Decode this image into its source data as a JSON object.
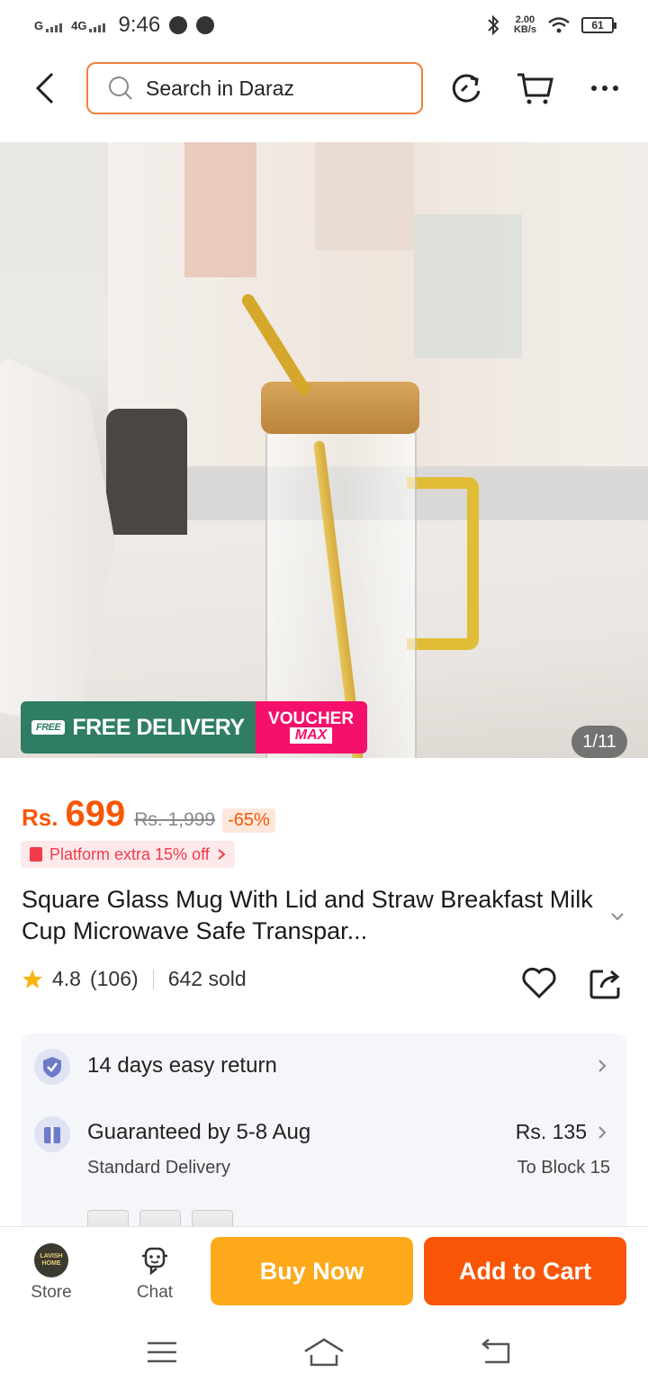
{
  "status_bar": {
    "signal1": "G",
    "signal2": "4G",
    "time": "9:46",
    "speed_value": "2.00",
    "speed_unit": "KB/s",
    "battery": "61"
  },
  "header": {
    "search_placeholder": "Search in Daraz",
    "icons": [
      "back-icon",
      "search-icon",
      "history-icon",
      "cart-icon",
      "more-icon"
    ]
  },
  "hero": {
    "free_badge": "FREE",
    "free_delivery": "FREE DELIVERY",
    "voucher_line1": "VOUCHER",
    "voucher_line2": "MAX",
    "counter": "1/11"
  },
  "product": {
    "currency": "Rs.",
    "price": "699",
    "old_price": "Rs. 1,999",
    "discount": "-65%",
    "platform_offer": "Platform extra 15% off",
    "title": "Square Glass Mug With Lid and Straw Breakfast Milk Cup Microwave Safe Transpar...",
    "rating": "4.8",
    "rating_count": "(106)",
    "sold": "642 sold"
  },
  "service": {
    "return_text": "14 days easy return",
    "delivery_title": "Guaranteed by 5-8 Aug",
    "delivery_sub": "Standard Delivery",
    "delivery_price": "Rs. 135",
    "delivery_to": "To Block 15"
  },
  "bottom_bar": {
    "store_label": "Store",
    "store_logo_line1": "LAVISH",
    "store_logo_line2": "HOME",
    "chat_label": "Chat",
    "buy_now": "Buy Now",
    "add_to_cart": "Add to Cart"
  },
  "colors": {
    "brand_orange": "#f85606",
    "buy_yellow": "#fda91a",
    "free_green": "#2f7d64",
    "voucher_pink": "#f5106b"
  }
}
